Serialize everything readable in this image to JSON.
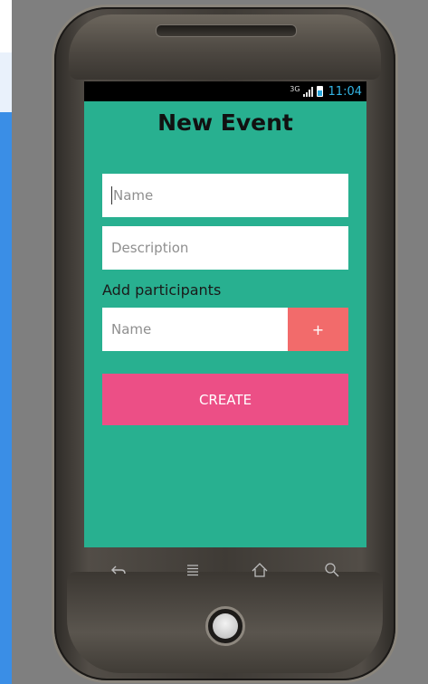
{
  "status_bar": {
    "network": "3G",
    "time": "11:04"
  },
  "app": {
    "title": "New Event",
    "name_placeholder": "Name",
    "description_placeholder": "Description",
    "participants_label": "Add participants",
    "participant_placeholder": "Name",
    "add_button": "+",
    "create_button": "CREATE"
  },
  "colors": {
    "app_background": "#28b090",
    "add_button": "#f26b6b",
    "create_button": "#ec4f86",
    "clock": "#33b5e5"
  },
  "hardware_keys": [
    "back-icon",
    "menu-icon",
    "home-icon",
    "search-icon"
  ]
}
